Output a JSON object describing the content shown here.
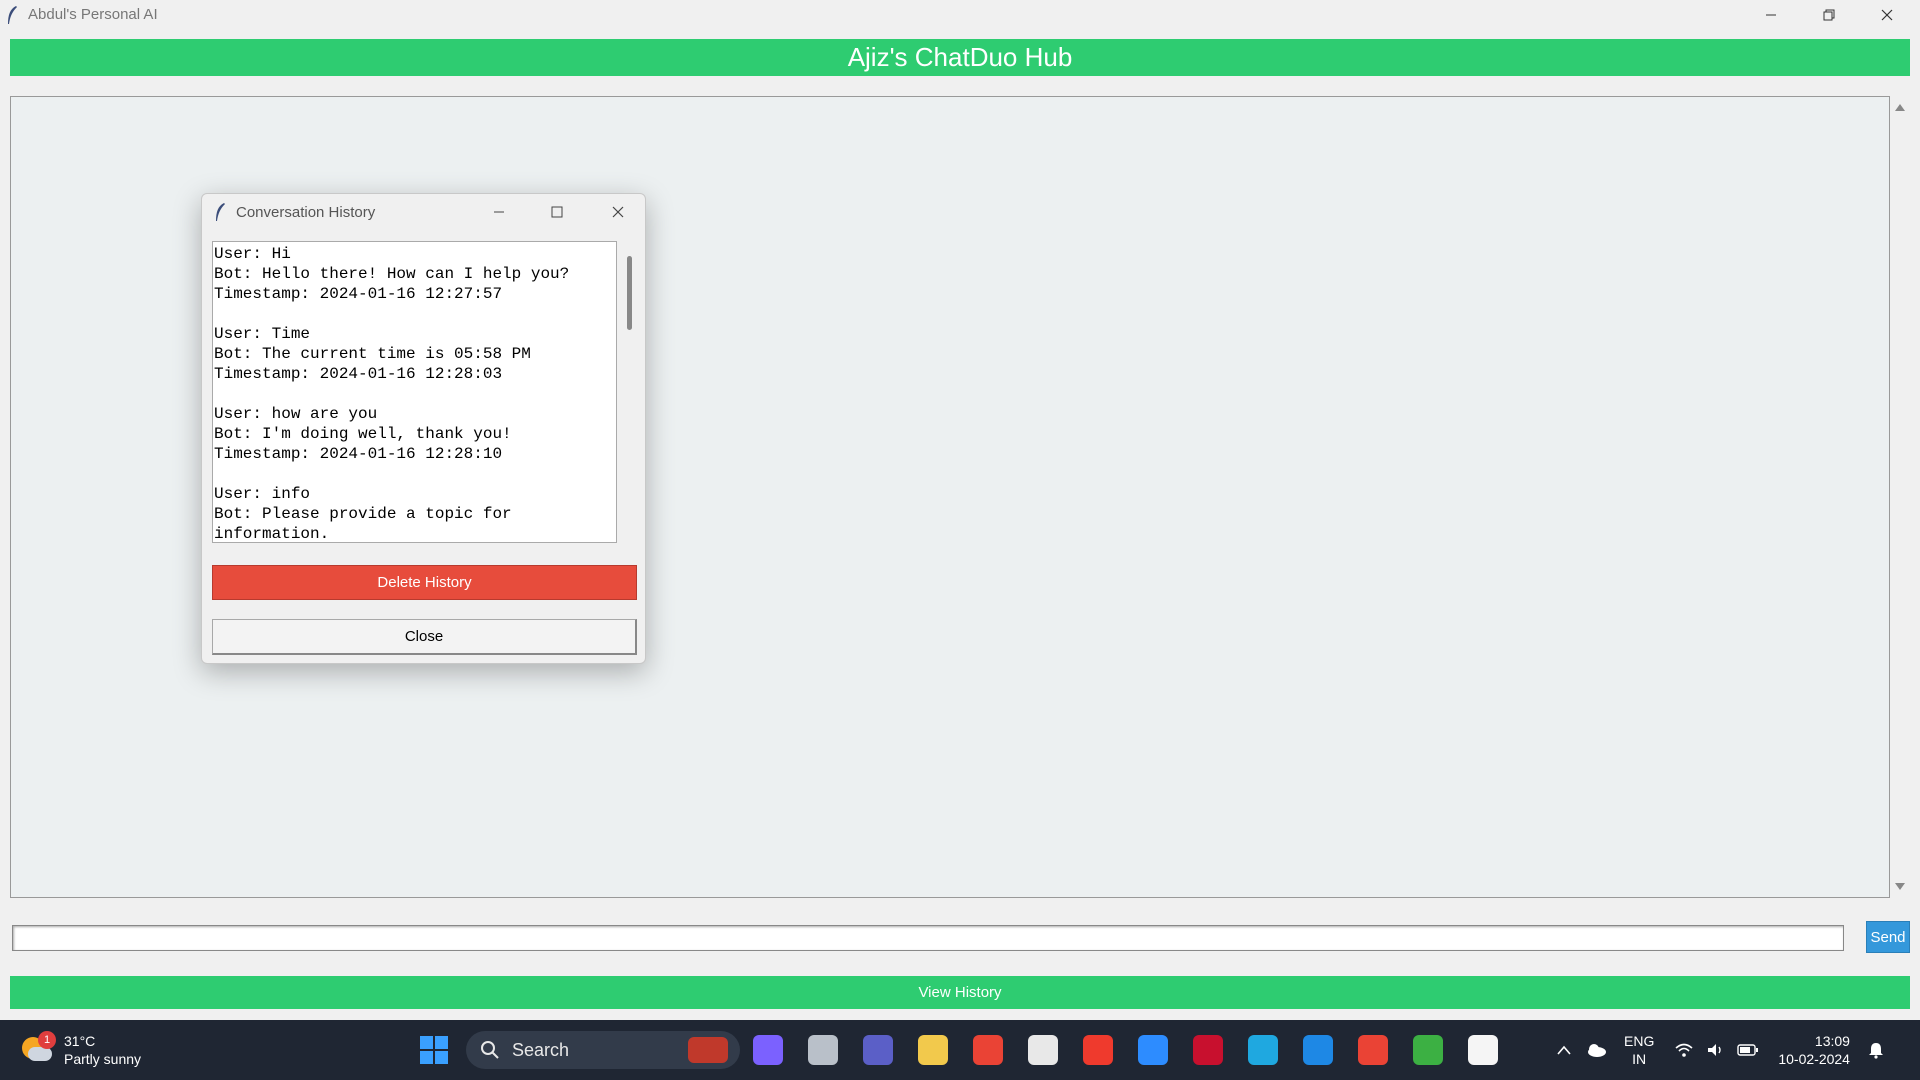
{
  "window": {
    "title": "Abdul's Personal AI"
  },
  "header": {
    "title": "Ajiz's ChatDuo Hub"
  },
  "input": {
    "value": "",
    "send_label": "Send"
  },
  "history_button_label": "View History",
  "dialog": {
    "title": "Conversation History",
    "history_text": "User: Hi\nBot: Hello there! How can I help you?\nTimestamp: 2024-01-16 12:27:57\n\nUser: Time\nBot: The current time is 05:58 PM\nTimestamp: 2024-01-16 12:28:03\n\nUser: how are you\nBot: I'm doing well, thank you!\nTimestamp: 2024-01-16 12:28:10\n\nUser: info\nBot: Please provide a topic for\ninformation.",
    "delete_label": "Delete History",
    "close_label": "Close"
  },
  "colors": {
    "accent_green": "#2ecc71",
    "delete_red": "#e74c3c",
    "send_blue": "#3498db"
  },
  "taskbar": {
    "weather": {
      "badge": "1",
      "temp": "31°C",
      "condition": "Partly sunny"
    },
    "search_label": "Search",
    "apps": [
      {
        "name": "copilot-icon",
        "color": "#7b61ff"
      },
      {
        "name": "task-view-icon",
        "color": "#b9c0c9"
      },
      {
        "name": "teams-icon",
        "color": "#5b5fc7"
      },
      {
        "name": "file-explorer-icon",
        "color": "#f2c94c"
      },
      {
        "name": "chrome-icon",
        "color": "#ea4335"
      },
      {
        "name": "microsoft-store-icon",
        "color": "#e8e8e8"
      },
      {
        "name": "anydesk-icon",
        "color": "#ef3a2d"
      },
      {
        "name": "get-help-icon",
        "color": "#2d8cff"
      },
      {
        "name": "mcafee-icon",
        "color": "#c8102e"
      },
      {
        "name": "edge-icon",
        "color": "#1fa8e0"
      },
      {
        "name": "vscode-icon",
        "color": "#1e88e5"
      },
      {
        "name": "chrome-profile-icon",
        "color": "#ea4335"
      },
      {
        "name": "loading-app-icon",
        "color": "#3cb043"
      },
      {
        "name": "notepad-icon",
        "color": "#f5f5f5"
      }
    ],
    "lang": {
      "line1": "ENG",
      "line2": "IN"
    },
    "clock": {
      "time": "13:09",
      "date": "10-02-2024"
    }
  }
}
